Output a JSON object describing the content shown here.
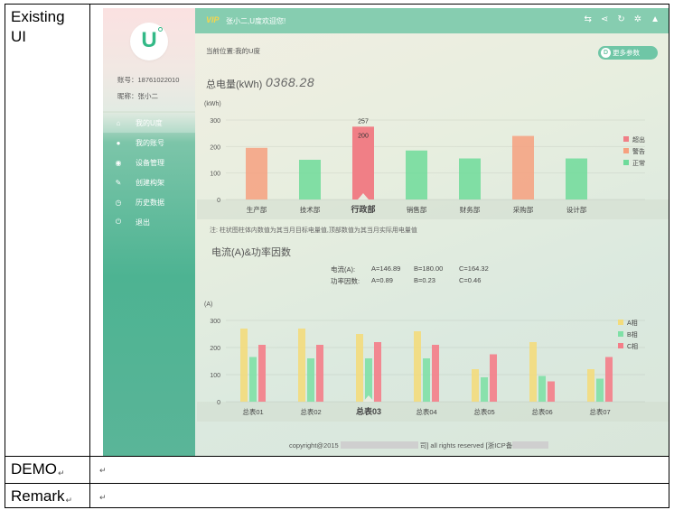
{
  "rows": {
    "existing_ui": "Existing UI",
    "demo": "DEMO",
    "remark": "Remark",
    "return_mark": "↵"
  },
  "app": {
    "vip": "VIP",
    "welcome": "张小二,U度欢迎您!",
    "account_label": "账号：18761022010",
    "nickname_label": "昵称：张小二",
    "logo_letter": "U",
    "breadcrumb": "当前位置:我的U度",
    "more_params": "更多参数",
    "footer_left": "copyright@2015",
    "footer_mid": "司] all rights reserved [浙ICP备",
    "colors": {
      "accent": "#33b987",
      "topbar": "#86cdb0",
      "over": "#f07f86",
      "warn": "#f6a07f",
      "normal": "#6edb9a"
    }
  },
  "menu": [
    {
      "label": "我的U度",
      "icon": "home-icon"
    },
    {
      "label": "我的账号",
      "icon": "user-icon"
    },
    {
      "label": "设备管理",
      "icon": "device-icon"
    },
    {
      "label": "创建构架",
      "icon": "build-icon"
    },
    {
      "label": "历史数据",
      "icon": "history-icon"
    },
    {
      "label": "退出",
      "icon": "power-icon"
    }
  ],
  "toolbar_icons": [
    "sync-icon",
    "share-icon",
    "refresh-icon",
    "settings-icon",
    "alert-icon"
  ],
  "power": {
    "title": "总电量(kWh)",
    "reading": "0368.28",
    "note": "注: 柱状图柱体内数值为其当月目标电量值,顶部数值为其当月实际用电量值"
  },
  "current": {
    "title": "电流(A)&功率因数",
    "current_label": "电流(A):",
    "current_a": "A=146.89",
    "current_b": "B=180.00",
    "current_c": "C=164.32",
    "pf_label": "功率因数:",
    "pf_a": "A=0.89",
    "pf_b": "B=0.23",
    "pf_c": "C=0.46"
  },
  "chart_data": [
    {
      "type": "bar",
      "ylabel": "(kWh)",
      "ylim": [
        0,
        300
      ],
      "yticks": [
        0,
        100,
        200,
        300
      ],
      "categories": [
        "生产部",
        "技术部",
        "行政部",
        "销售部",
        "财务部",
        "采购部",
        "设计部"
      ],
      "values": [
        195,
        150,
        275,
        185,
        155,
        240,
        155
      ],
      "status": [
        "警告",
        "正常",
        "超出",
        "正常",
        "正常",
        "警告",
        "正常"
      ],
      "highlight_index": 2,
      "highlight_top_label": "257",
      "highlight_inner_label": "200",
      "legend": [
        "超出",
        "警告",
        "正常"
      ],
      "legend_colors": [
        "#f07f86",
        "#f6a07f",
        "#6edb9a"
      ],
      "legend_position": "right"
    },
    {
      "type": "bar",
      "ylabel": "(A)",
      "ylim": [
        0,
        300
      ],
      "yticks": [
        0,
        100,
        200,
        300
      ],
      "categories": [
        "总表01",
        "总表02",
        "总表03",
        "总表04",
        "总表05",
        "总表06",
        "总表07"
      ],
      "highlight_index": 2,
      "series": [
        {
          "name": "A相",
          "color": "#f3dc7c",
          "values": [
            270,
            270,
            250,
            260,
            120,
            220,
            120
          ]
        },
        {
          "name": "B相",
          "color": "#7fe0a6",
          "values": [
            165,
            160,
            160,
            160,
            90,
            95,
            85
          ]
        },
        {
          "name": "C相",
          "color": "#f47d88",
          "values": [
            210,
            210,
            220,
            210,
            175,
            75,
            165
          ]
        }
      ],
      "legend_position": "right"
    }
  ]
}
